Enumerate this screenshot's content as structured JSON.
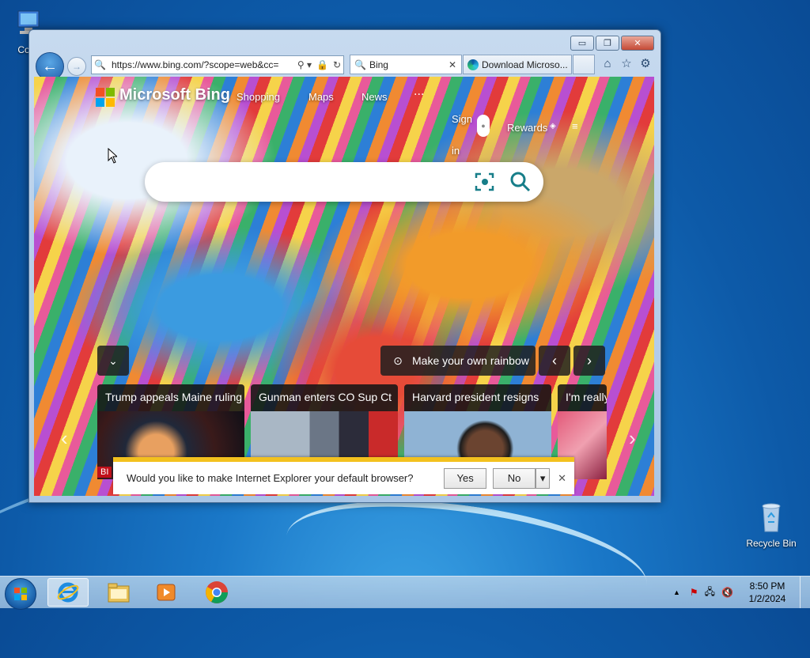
{
  "desktop": {
    "icons": [
      {
        "label": "Com",
        "name": "computer"
      },
      {
        "label": "Recycle Bin",
        "name": "recycle-bin"
      }
    ]
  },
  "ie": {
    "window_controls": {
      "minimize": "▭",
      "maximize": "❐",
      "close": "✕"
    },
    "address": "https://www.bing.com/?scope=web&cc=",
    "tabs": [
      {
        "label": "Bing",
        "active": true
      },
      {
        "label": "Download Microso...",
        "active": false
      }
    ]
  },
  "bing": {
    "brand": "Microsoft Bing",
    "nav": [
      "Shopping",
      "Maps",
      "News"
    ],
    "more": "...",
    "sign_in": "Sign in",
    "rewards": "Rewards",
    "search_placeholder": "",
    "image_caption": "Make your own rainbow",
    "news": [
      "Trump appeals Maine ruling",
      "Gunman enters CO Sup Ct",
      "Harvard president resigns",
      "I'm really"
    ],
    "thumb_tag": "BI"
  },
  "notification": {
    "message": "Would you like to make Internet Explorer your default browser?",
    "yes": "Yes",
    "no": "No"
  },
  "taskbar": {
    "time": "8:50 PM",
    "date": "1/2/2024"
  },
  "colors": {
    "accent": "#1f5ea8",
    "notif_bar": "#f3c11e",
    "ms_red": "#f25022",
    "ms_green": "#7fba00",
    "ms_blue": "#00a4ef",
    "ms_yellow": "#ffb900",
    "bing_teal": "#177e89"
  }
}
